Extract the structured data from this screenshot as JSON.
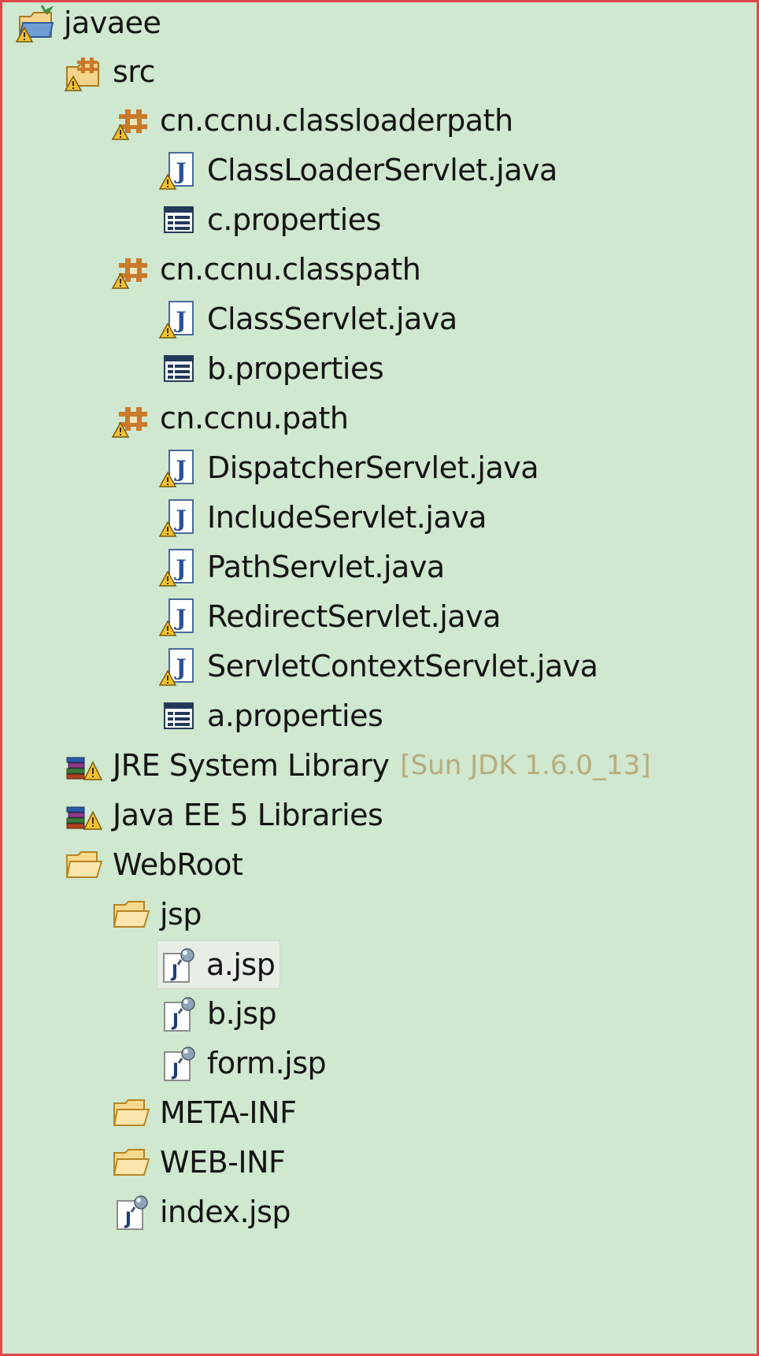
{
  "tree": {
    "project": {
      "label": "javaee",
      "icon": "project-icon"
    },
    "src": {
      "label": "src",
      "icon": "source-folder-icon"
    },
    "pkg_classloaderpath": {
      "label": "cn.ccnu.classloaderpath",
      "icon": "package-icon",
      "files": [
        {
          "label": "ClassLoaderServlet.java",
          "icon": "java-file-icon"
        },
        {
          "label": "c.properties",
          "icon": "properties-file-icon"
        }
      ]
    },
    "pkg_classpath": {
      "label": "cn.ccnu.classpath",
      "icon": "package-icon",
      "files": [
        {
          "label": "ClassServlet.java",
          "icon": "java-file-icon"
        },
        {
          "label": "b.properties",
          "icon": "properties-file-icon"
        }
      ]
    },
    "pkg_path": {
      "label": "cn.ccnu.path",
      "icon": "package-icon",
      "files": [
        {
          "label": "DispatcherServlet.java",
          "icon": "java-file-icon"
        },
        {
          "label": "IncludeServlet.java",
          "icon": "java-file-icon"
        },
        {
          "label": "PathServlet.java",
          "icon": "java-file-icon"
        },
        {
          "label": "RedirectServlet.java",
          "icon": "java-file-icon"
        },
        {
          "label": "ServletContextServlet.java",
          "icon": "java-file-icon"
        },
        {
          "label": "a.properties",
          "icon": "properties-file-icon"
        }
      ]
    },
    "jre": {
      "label": "JRE System Library",
      "decoration": "[Sun JDK 1.6.0_13]",
      "icon": "library-icon"
    },
    "javaee_libs": {
      "label": "Java EE 5 Libraries",
      "icon": "library-icon"
    },
    "webroot": {
      "label": "WebRoot",
      "icon": "folder-open-icon",
      "jsp_folder": {
        "label": "jsp",
        "icon": "folder-open-icon",
        "files": [
          {
            "label": "a.jsp",
            "icon": "jsp-file-icon",
            "selected": true
          },
          {
            "label": "b.jsp",
            "icon": "jsp-file-icon"
          },
          {
            "label": "form.jsp",
            "icon": "jsp-file-icon"
          }
        ]
      },
      "meta_inf": {
        "label": "META-INF",
        "icon": "folder-open-icon"
      },
      "web_inf": {
        "label": "WEB-INF",
        "icon": "folder-open-icon"
      },
      "index": {
        "label": "index.jsp",
        "icon": "jsp-file-icon"
      }
    }
  },
  "colors": {
    "background": "#cfe8cf",
    "border": "#e04848",
    "decoration_text": "#b8ab7c"
  }
}
